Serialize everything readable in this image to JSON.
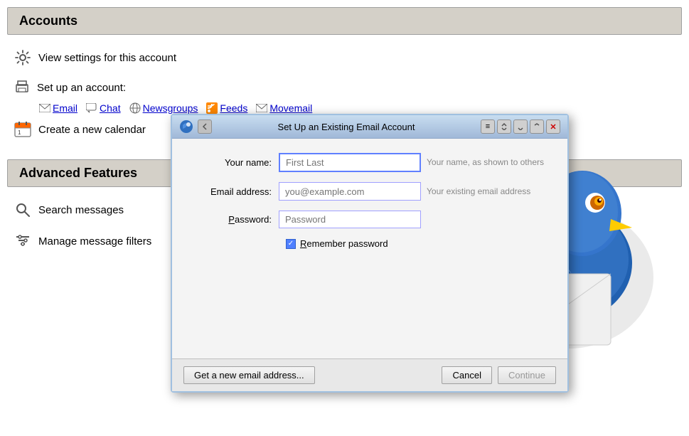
{
  "accounts": {
    "header": "Accounts",
    "view_settings": "View settings for this account",
    "setup_account_label": "Set up an account:",
    "account_types": [
      {
        "id": "email",
        "label": "Email",
        "icon": "email-icon"
      },
      {
        "id": "chat",
        "label": "Chat",
        "icon": "chat-icon"
      },
      {
        "id": "newsgroups",
        "label": "Newsgroups",
        "icon": "newsgroups-icon"
      },
      {
        "id": "feeds",
        "label": "Feeds",
        "icon": "feeds-icon"
      },
      {
        "id": "movemail",
        "label": "Movemail",
        "icon": "movemail-icon"
      }
    ],
    "create_calendar": "Create a new calendar"
  },
  "advanced_features": {
    "header": "Advanced Features",
    "items": [
      {
        "id": "search",
        "label": "Search messages",
        "icon": "search-icon"
      },
      {
        "id": "filters",
        "label": "Manage message filters",
        "icon": "filters-icon"
      }
    ]
  },
  "dialog": {
    "title": "Set Up an Existing Email Account",
    "fields": {
      "name": {
        "label": "Your name:",
        "placeholder": "First Last",
        "hint": "Your name, as shown to others"
      },
      "email": {
        "label": "Email address:",
        "placeholder": "you@example.com",
        "hint": "Your existing email address"
      },
      "password": {
        "label": "Password:",
        "placeholder": "Password",
        "hint": ""
      }
    },
    "remember_password": "Re̲member password",
    "remember_password_display": "Remember password",
    "footer": {
      "get_new_email": "Get a new email address...",
      "cancel": "Cancel",
      "continue": "Continue"
    }
  }
}
